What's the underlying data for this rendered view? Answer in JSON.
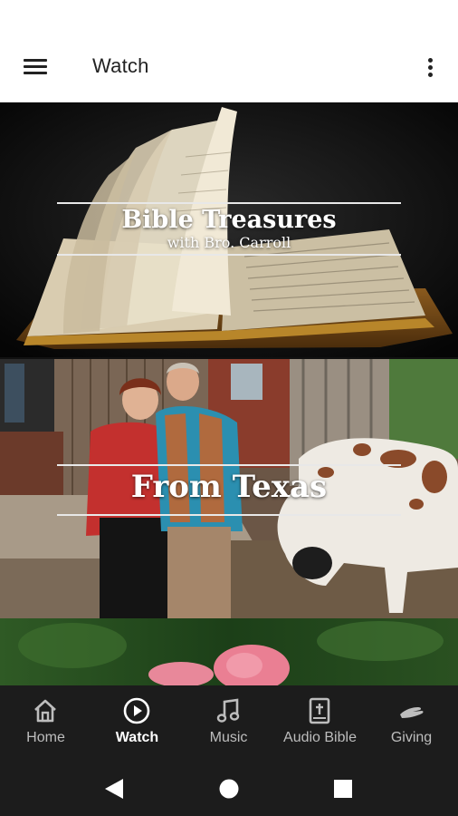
{
  "app_bar": {
    "title": "Watch",
    "menu_icon": "hamburger-menu-icon",
    "more_icon": "more-vert-icon"
  },
  "cards": [
    {
      "title": "Bible Treasures",
      "subtitle": "with Bro. Carroll",
      "image": "open-bible-photo"
    },
    {
      "title": "From Texas",
      "subtitle": "",
      "image": "couple-with-horse-photo"
    },
    {
      "title": "",
      "subtitle": "",
      "image": "pink-flowers-photo"
    }
  ],
  "bottom_nav": {
    "items": [
      {
        "label": "Home",
        "icon": "home-icon",
        "active": false
      },
      {
        "label": "Watch",
        "icon": "play-circle-icon",
        "active": true
      },
      {
        "label": "Music",
        "icon": "music-note-icon",
        "active": false
      },
      {
        "label": "Audio Bible",
        "icon": "bible-book-icon",
        "active": false
      },
      {
        "label": "Giving",
        "icon": "giving-hand-icon",
        "active": false
      }
    ]
  },
  "system_nav": {
    "back_icon": "back-triangle-icon",
    "home_icon": "home-circle-icon",
    "recents_icon": "recents-square-icon"
  },
  "colors": {
    "nav_background": "#1c1c1c",
    "nav_active": "#ffffff",
    "nav_inactive": "#bdbdbd",
    "app_bar_background": "#ffffff"
  }
}
